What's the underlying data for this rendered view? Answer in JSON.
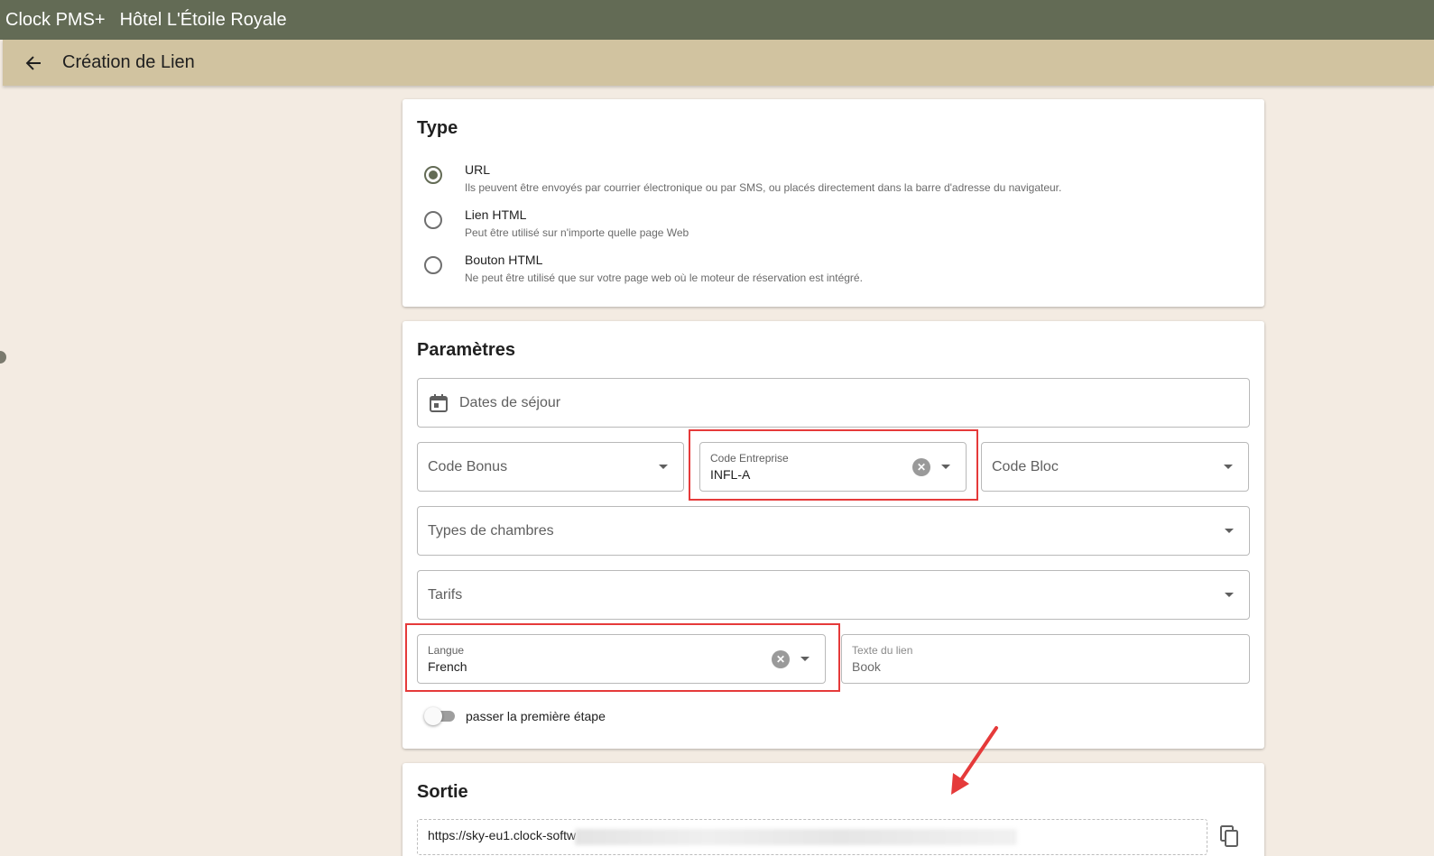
{
  "app": {
    "name": "Clock PMS+",
    "hotel": "Hôtel L'Étoile Royale"
  },
  "page": {
    "title": "Création de Lien",
    "back_icon": "arrow-left-icon"
  },
  "type_section": {
    "heading": "Type",
    "options": [
      {
        "label": "URL",
        "description": "Ils peuvent être envoyés par courrier électronique ou par SMS, ou placés directement dans la barre d'adresse du navigateur.",
        "selected": true
      },
      {
        "label": "Lien HTML",
        "description": "Peut être utilisé sur n'importe quelle page Web",
        "selected": false
      },
      {
        "label": "Bouton HTML",
        "description": "Ne peut être utilisé que sur votre page web où le moteur de réservation est intégré.",
        "selected": false
      }
    ]
  },
  "params": {
    "heading": "Paramètres",
    "dates_placeholder": "Dates de séjour",
    "code_bonus_placeholder": "Code Bonus",
    "code_entreprise": {
      "label": "Code Entreprise",
      "value": "INFL-A"
    },
    "code_bloc_placeholder": "Code Bloc",
    "room_types_placeholder": "Types de chambres",
    "tarifs_placeholder": "Tarifs",
    "langue": {
      "label": "Langue",
      "value": "French"
    },
    "link_text": {
      "label": "Texte du lien",
      "value": "Book"
    },
    "skip_first_step": {
      "label": "passer la première étape",
      "enabled": false
    }
  },
  "output": {
    "heading": "Sortie",
    "url_visible": "https://sky-eu1.clock-softw"
  },
  "colors": {
    "topbar": "#636b55",
    "subbar": "#d1c3a0",
    "background": "#f3ebe2",
    "highlight": "#e53a3a"
  }
}
